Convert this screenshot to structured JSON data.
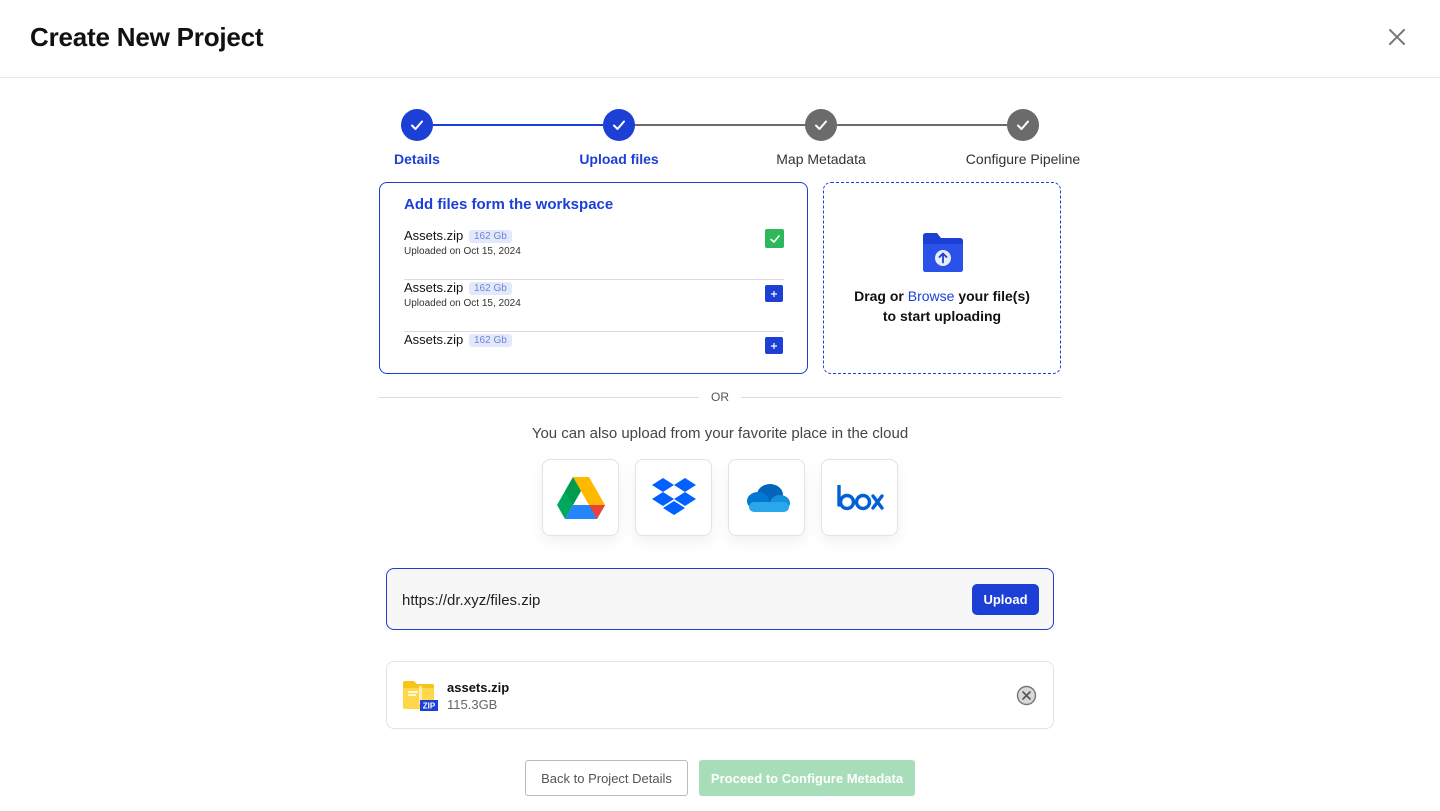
{
  "header": {
    "title": "Create New Project"
  },
  "stepper": {
    "steps": [
      {
        "label": "Details",
        "status": "completed"
      },
      {
        "label": "Upload files",
        "status": "current"
      },
      {
        "label": "Map Metadata",
        "status": "pending"
      },
      {
        "label": "Configure Pipeline",
        "status": "pending"
      }
    ]
  },
  "workspace": {
    "title": "Add files form the workspace",
    "files": [
      {
        "name": "Assets.zip",
        "size": "162 Gb",
        "date": "Uploaded on Oct 15, 2024",
        "selected": true
      },
      {
        "name": "Assets.zip",
        "size": "162 Gb",
        "date": "Uploaded on Oct 15, 2024",
        "selected": false
      },
      {
        "name": "Assets.zip",
        "size": "162 Gb",
        "date": "",
        "selected": false
      }
    ]
  },
  "dropzone": {
    "prefix": "Drag or",
    "browse": "Browse",
    "suffix": "your file(s)",
    "line2": "to start uploading"
  },
  "divider": {
    "text": "OR"
  },
  "cloud": {
    "text": "You can also upload from your favorite place in the cloud",
    "providers": [
      "google-drive",
      "dropbox",
      "onedrive",
      "box"
    ]
  },
  "url_upload": {
    "value": "https://dr.xyz/files.zip",
    "button": "Upload"
  },
  "uploaded_file": {
    "name": "assets.zip",
    "size": "115.3GB",
    "badge": "ZIP"
  },
  "footer": {
    "back": "Back to Project Details",
    "proceed": "Proceed to Configure Metadata"
  },
  "colors": {
    "accent": "#1c3fd6",
    "success": "#2eb85c",
    "disabled_proceed": "#a8ddb9"
  }
}
